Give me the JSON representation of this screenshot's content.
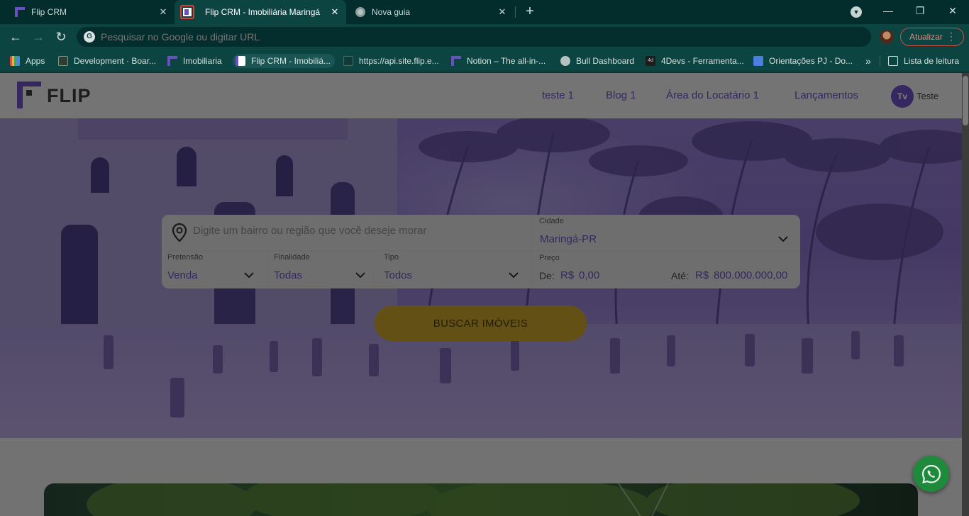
{
  "browser": {
    "tabs": [
      {
        "title": "Flip CRM",
        "icon": "flip-favicon"
      },
      {
        "title": "Flip CRM - Imobiliária Maringá",
        "icon": "flip-favicon",
        "active": true
      },
      {
        "title": "Nova guia",
        "icon": "chrome-favicon"
      }
    ],
    "omnibox_placeholder": "Pesquisar no Google ou digitar URL",
    "update_label": "Atualizar",
    "bookmarks": [
      {
        "label": "Apps",
        "icon": "apps-grid-icon"
      },
      {
        "label": "Development · Boar...",
        "icon": "board-icon"
      },
      {
        "label": "Imobiliaria",
        "icon": "flip-favicon"
      },
      {
        "label": "Flip CRM - Imobiliá...",
        "icon": "flip-favicon"
      },
      {
        "label": "https://api.site.flip.e...",
        "icon": "page-icon"
      },
      {
        "label": "Notion – The all-in-...",
        "icon": "flip-favicon"
      },
      {
        "label": "Bull Dashboard",
        "icon": "globe-icon"
      },
      {
        "label": "4Devs - Ferramenta...",
        "icon": "4devs-icon"
      },
      {
        "label": "Orientações PJ - Do...",
        "icon": "docs-icon"
      }
    ],
    "more_bookmarks": "»",
    "reading_list": "Lista de leitura"
  },
  "site": {
    "logo_text": "FLIP",
    "nav": [
      "teste 1",
      "Blog 1",
      "Área do Locatário 1",
      "Lançamentos"
    ],
    "user_initials": "Tv",
    "user_name": "Teste"
  },
  "search": {
    "location_placeholder": "Digite um bairro ou região que você deseje morar",
    "cidade_label": "Cidade",
    "cidade_value": "Maringá-PR",
    "pretensao_label": "Pretensão",
    "pretensao_value": "Venda",
    "finalidade_label": "Finalidade",
    "finalidade_value": "Todas",
    "tipo_label": "Tipo",
    "tipo_value": "Todos",
    "preco_label": "Preço",
    "de_label": "De:",
    "de_currency": "R$",
    "de_value": "0,00",
    "ate_label": "Até:",
    "ate_currency": "R$",
    "ate_value": "800.000.000,00",
    "button_label": "BUSCAR IMÓVEIS"
  },
  "colors": {
    "brand_purple": "#6a4fc0",
    "button_gold": "#c4a12a",
    "whatsapp_green": "#1f8a3c",
    "tab_active": "#0c4442"
  }
}
